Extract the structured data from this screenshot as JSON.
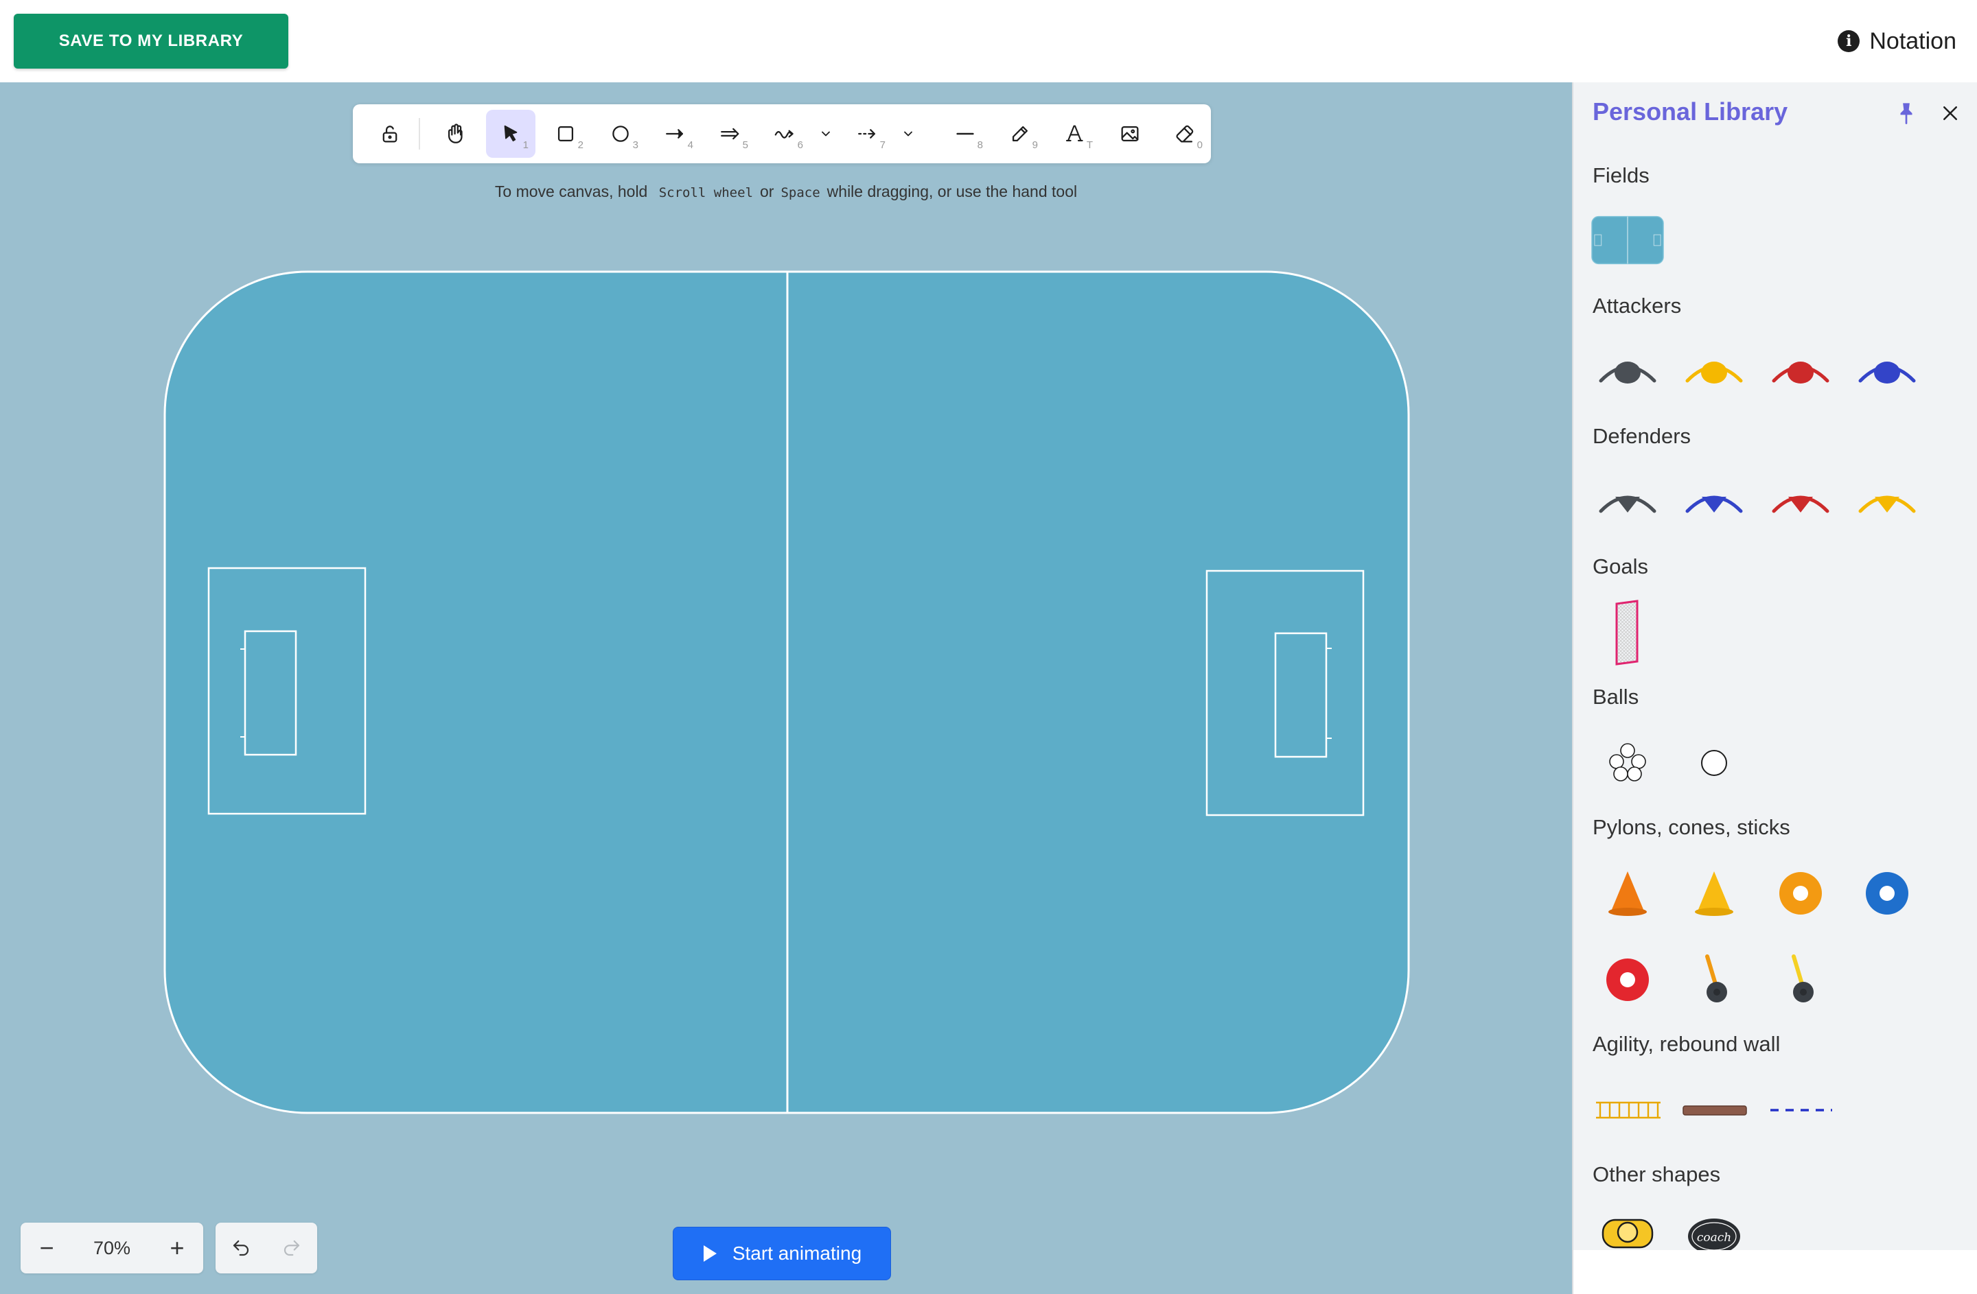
{
  "header": {
    "save_label": "SAVE TO MY LIBRARY",
    "notation_label": "Notation",
    "info_icon": "info-icon"
  },
  "toolbar": {
    "tools": [
      {
        "name": "lock",
        "icon": "lock-open-icon",
        "key": ""
      },
      {
        "name": "hand",
        "icon": "hand-icon",
        "key": ""
      },
      {
        "name": "selection",
        "icon": "pointer-icon",
        "key": "1",
        "active": true
      },
      {
        "name": "rectangle",
        "icon": "rectangle-icon",
        "key": "2"
      },
      {
        "name": "ellipse",
        "icon": "ellipse-icon",
        "key": "3"
      },
      {
        "name": "arrow",
        "icon": "arrow-icon",
        "key": "4"
      },
      {
        "name": "double-arrow",
        "icon": "double-arrow-icon",
        "key": "5"
      },
      {
        "name": "wavy-arrow",
        "icon": "wavy-arrow-icon",
        "key": "6"
      },
      {
        "name": "dashed-arrow",
        "icon": "dashed-arrow-icon",
        "key": "7"
      },
      {
        "name": "line",
        "icon": "line-icon",
        "key": "8"
      },
      {
        "name": "draw",
        "icon": "pencil-icon",
        "key": "9"
      },
      {
        "name": "text",
        "icon": "text-icon",
        "key": "T"
      },
      {
        "name": "image",
        "icon": "image-icon",
        "key": ""
      },
      {
        "name": "eraser",
        "icon": "eraser-icon",
        "key": "0"
      }
    ]
  },
  "hint": {
    "prefix": "To move canvas, hold",
    "key1": "Scroll wheel",
    "middle": "or",
    "key2": "Space",
    "suffix": "while dragging, or use the hand tool"
  },
  "zoom": {
    "value": "70%",
    "minus_label": "−",
    "plus_label": "+"
  },
  "animate": {
    "label": "Start animating"
  },
  "library": {
    "title": "Personal Library",
    "sections": {
      "fields": "Fields",
      "attackers": "Attackers",
      "defenders": "Defenders",
      "goals": "Goals",
      "balls": "Balls",
      "pylons": "Pylons, cones, sticks",
      "agility": "Agility, rebound wall",
      "other": "Other shapes"
    },
    "other_coach_label": "coach"
  },
  "colors": {
    "accent": "#6965db",
    "save_green": "#0e9567",
    "field_blue": "#5dadc8",
    "canvas_bg": "#9bbfcf",
    "animate_blue": "#1f6ff5",
    "player_gray": "#4a4f55",
    "player_yellow": "#f5b800",
    "player_red": "#cc2a2a",
    "player_blue": "#3344c8"
  }
}
